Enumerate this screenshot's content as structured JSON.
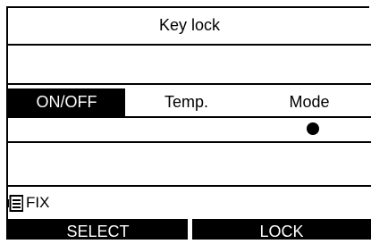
{
  "header": {
    "title": "Key lock"
  },
  "tabs": [
    {
      "label": "ON/OFF",
      "active": true
    },
    {
      "label": "Temp.",
      "active": false
    },
    {
      "label": "Mode",
      "active": false
    }
  ],
  "lock_indicator": {
    "column": "Mode",
    "icon": "filled-circle-icon"
  },
  "status": {
    "icon": "menu-list-icon",
    "text": "FIX"
  },
  "softkeys": {
    "left": "SELECT",
    "right": "LOCK"
  },
  "colors": {
    "foreground": "#000000",
    "background": "#ffffff"
  }
}
